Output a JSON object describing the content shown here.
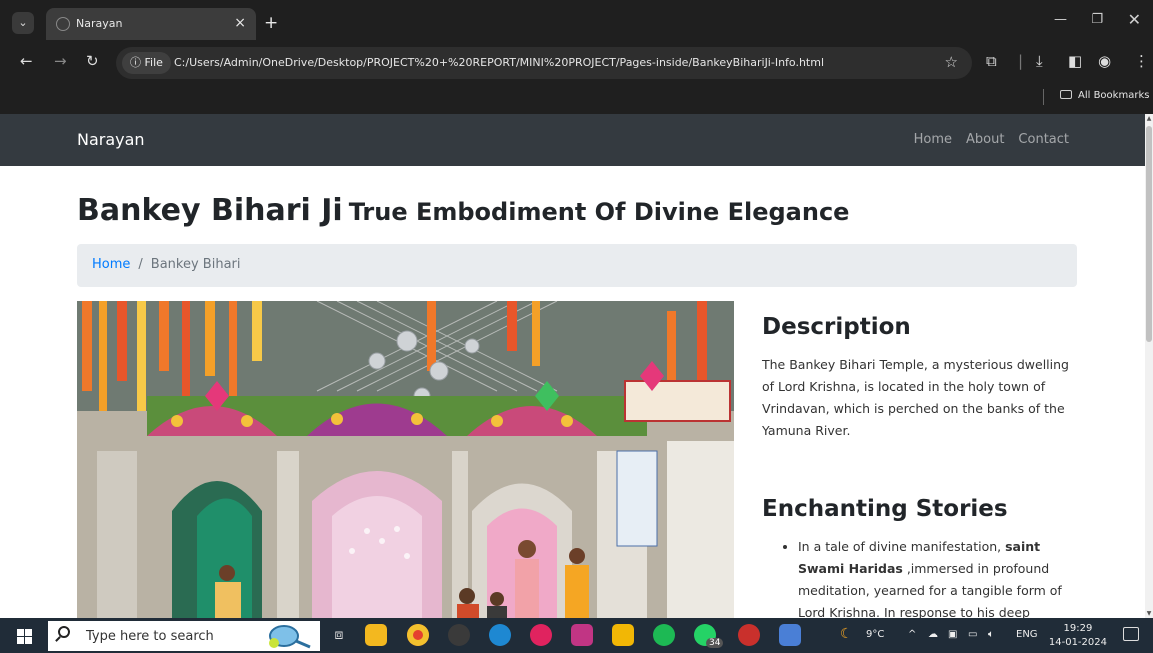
{
  "browser": {
    "tab_title": "Narayan",
    "tab_close": "×",
    "new_tab": "+",
    "tab_menu": "⌄",
    "site_chip": "ⓘ File",
    "url": "C:/Users/Admin/OneDrive/Desktop/PROJECT%20+%20REPORT/MINI%20PROJECT/Pages-inside/BankeyBihariJi-Info.html",
    "all_bookmarks": "All Bookmarks",
    "icons": [
      "back-arrow-icon",
      "forward-arrow-icon",
      "reload-icon",
      "star-icon",
      "extensions-icon",
      "download-icon",
      "sidepanel-icon",
      "profile-icon",
      "kebab-menu-icon"
    ]
  },
  "navbar": {
    "brand": "Narayan",
    "links": [
      "Home",
      "About",
      "Contact"
    ]
  },
  "page": {
    "title_main": "Bankey Bihari Ji",
    "title_sub": "True Embodiment Of Divine Elegance",
    "breadcrumb_home": "Home",
    "breadcrumb_sep": "/",
    "breadcrumb_active": "Bankey Bihari",
    "desc_heading": "Description",
    "desc_text": "The Bankey Bihari Temple, a mysterious dwelling of Lord Krishna, is located in the holy town of Vrindavan, which is perched on the banks of the Yamuna River.",
    "stories_heading": "Enchanting Stories",
    "story_prefix": "In a tale of divine manifestation,",
    "story_bold": "saint Swami Haridas",
    "story_rest": ",immersed in profound meditation, yearned for a tangible form of Lord Krishna. In response to his deep"
  },
  "taskbar": {
    "search_placeholder": "Type here to search",
    "weather": "9°C",
    "language": "ENG",
    "time": "19:29",
    "date": "14-01-2024",
    "whatsapp_badge": "34"
  },
  "colors": {
    "navbar_bg": "#343a40",
    "link_blue": "#007bff",
    "breadcrumb_bg": "#e9ecef",
    "chrome_bg": "#1f1f1f",
    "taskbar_bg": "#202c38"
  }
}
